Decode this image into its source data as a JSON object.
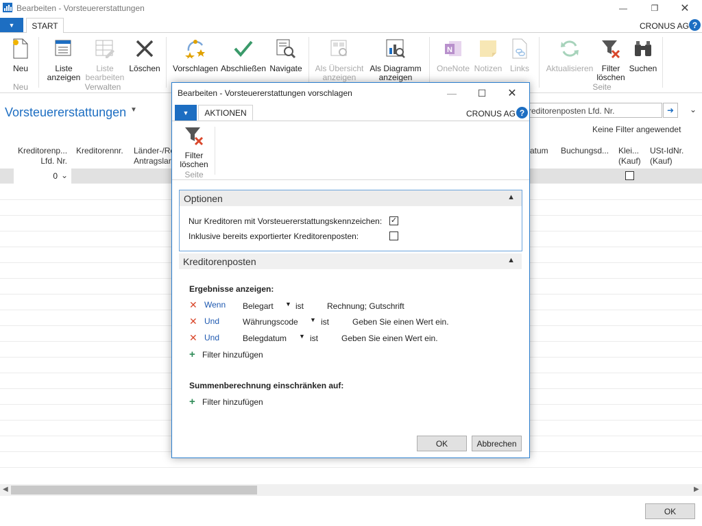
{
  "window": {
    "title": "Bearbeiten - Vorsteuererstattungen"
  },
  "ribbon": {
    "tab": "START",
    "company": "CRONUS AG",
    "buttons": {
      "neu": "Neu",
      "liste_anzeigen": "Liste\nanzeigen",
      "liste_bearbeiten": "Liste\nbearbeiten",
      "loeschen": "Löschen",
      "vorschlagen": "Vorschlagen",
      "abschliessen": "Abschließen",
      "navigate": "Navigate",
      "als_uebersicht": "Als Übersicht\nanzeigen",
      "als_diagramm": "Als Diagramm\nanzeigen",
      "onenote": "OneNote",
      "notizen": "Notizen",
      "links": "Links",
      "aktualisieren": "Aktualisieren",
      "filter_loeschen": "Filter\nlöschen",
      "suchen": "Suchen"
    },
    "groups": {
      "neu": "Neu",
      "verwalten": "Verwalten",
      "seite": "Seite"
    }
  },
  "page": {
    "title": "Vorsteuererstattungen",
    "search_value": "reditorenposten Lfd. Nr.",
    "no_filter": "Keine Filter angewendet",
    "columns": {
      "c1": "Kreditorenp...\nLfd. Nr.",
      "c2": "Kreditorennr.",
      "c3": "Länder-/Re\nAntragslar",
      "c4": "atum",
      "c5": "Buchungsd...",
      "c6": "Klei...\n(Kauf)",
      "c7": "USt-IdNr.\n(Kauf)"
    },
    "row": {
      "value": "0"
    },
    "ok": "OK"
  },
  "dialog": {
    "title": "Bearbeiten - Vorsteuererstattungen vorschlagen",
    "tab": "AKTIONEN",
    "company": "CRONUS AG",
    "filter_loeschen": "Filter\nlöschen",
    "group_seite": "Seite",
    "optionen": {
      "header": "Optionen",
      "opt1_label": "Nur Kreditoren mit Vorsteuererstattungskennzeichen:",
      "opt1_checked": true,
      "opt2_label": "Inklusive bereits exportierter Kreditorenposten:",
      "opt2_checked": false
    },
    "kreditorenposten": {
      "header": "Kreditorenposten",
      "ergebnisse": "Ergebnisse anzeigen:",
      "filters": [
        {
          "conj": "Wenn",
          "field": "Belegart",
          "op": "ist",
          "value": "Rechnung; Gutschrift"
        },
        {
          "conj": "Und",
          "field": "Währungscode",
          "op": "ist",
          "value": "Geben Sie einen Wert ein."
        },
        {
          "conj": "Und",
          "field": "Belegdatum",
          "op": "ist",
          "value": "Geben Sie einen Wert ein."
        }
      ],
      "add_filter": "Filter hinzufügen",
      "summen": "Summenberechnung einschränken auf:",
      "add_filter2": "Filter hinzufügen"
    },
    "ok": "OK",
    "cancel": "Abbrechen"
  }
}
